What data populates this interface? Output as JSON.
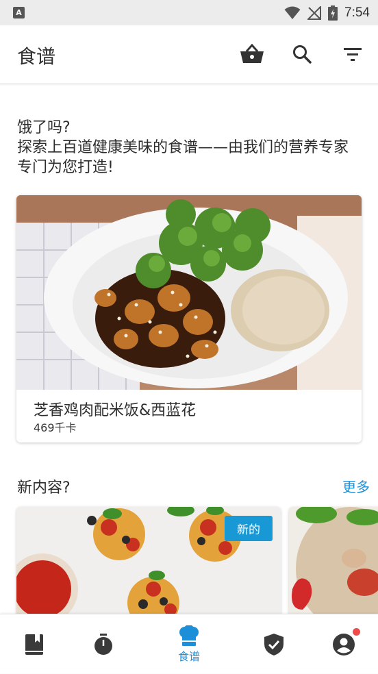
{
  "status_bar": {
    "time": "7:54",
    "icons": [
      "app-notification-icon",
      "wifi-icon",
      "no-signal-icon",
      "battery-charging-icon"
    ]
  },
  "app_bar": {
    "title": "食谱",
    "icons": [
      "basket-icon",
      "search-icon",
      "filter-icon"
    ]
  },
  "intro": {
    "line1": "饿了吗?",
    "line2": "探索上百道健康美味的食谱——由我们的营养专家专门为您打造!"
  },
  "featured_recipe": {
    "title": "芝香鸡肉配米饭&西蓝花",
    "calories": "469千卡"
  },
  "new_section": {
    "title": "新内容?",
    "more_label": "更多",
    "badge": "新的"
  },
  "bottom_nav": {
    "items": [
      {
        "icon": "book-icon",
        "label": ""
      },
      {
        "icon": "timer-icon",
        "label": ""
      },
      {
        "icon": "chef-hat-icon",
        "label": "食谱",
        "active": true
      },
      {
        "icon": "shield-check-icon",
        "label": ""
      },
      {
        "icon": "account-icon",
        "label": ""
      }
    ],
    "active_color": "#1d8fd8",
    "icon_color": "#3a3a3a",
    "notification_color": "#f04b4b"
  }
}
